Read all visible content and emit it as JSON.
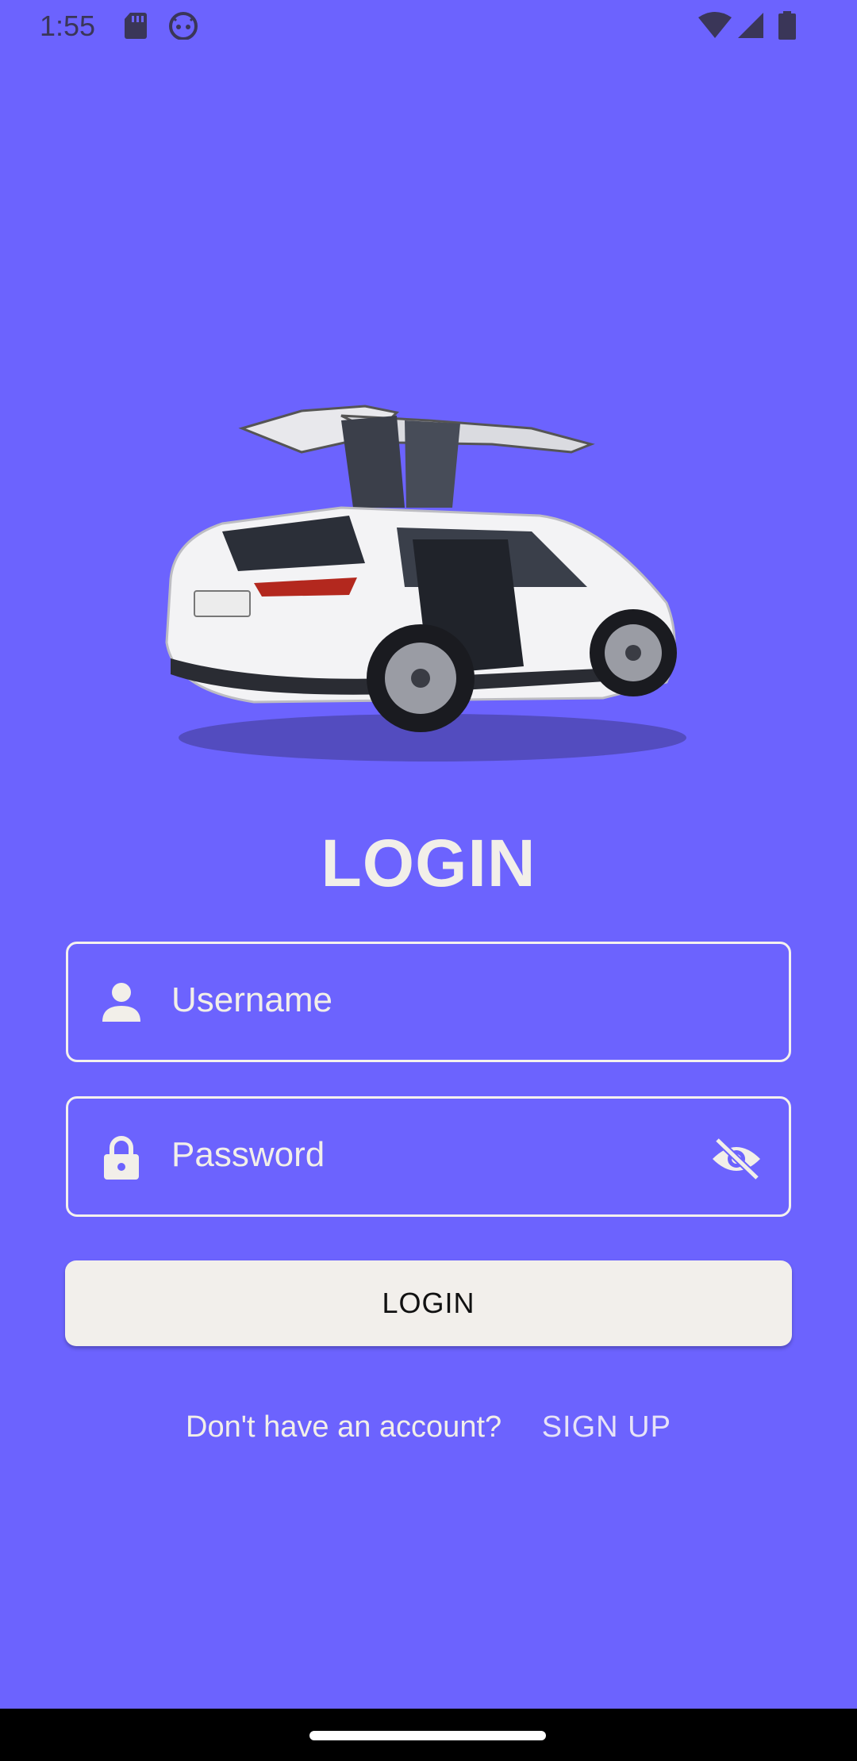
{
  "status_bar": {
    "time": "1:55",
    "icons_left": [
      "sd-card-icon",
      "android-head-icon"
    ],
    "icons_right": [
      "wifi-icon",
      "cellular-signal-icon",
      "battery-icon"
    ]
  },
  "hero": {
    "image": "car-illustration"
  },
  "title": "LOGIN",
  "username": {
    "placeholder": "Username",
    "icon": "person-icon"
  },
  "password": {
    "placeholder": "Password",
    "icon": "lock-icon",
    "toggle_icon": "visibility-off-icon"
  },
  "login_button": {
    "label": "LOGIN"
  },
  "signup": {
    "prompt": "Don't have an account?",
    "link": "SIGN UP"
  },
  "colors": {
    "background": "#6c63fe",
    "button": "#f2efeb",
    "text": "#f2efe9"
  }
}
